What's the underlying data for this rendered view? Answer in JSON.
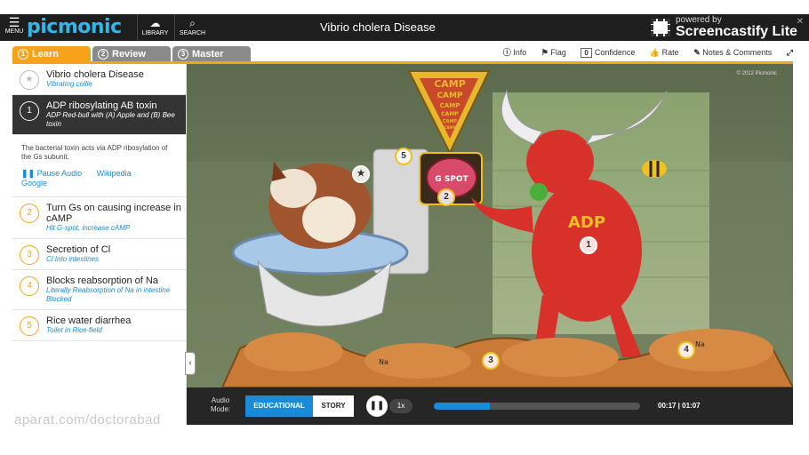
{
  "header": {
    "menu_label": "MENU",
    "logo_text": "picmonic",
    "library_label": "LIBRARY",
    "search_label": "SEARCH",
    "title": "Vibrio cholera Disease"
  },
  "recorder": {
    "powered_by": "powered by",
    "name": "Screencastify Lite"
  },
  "tabs": [
    {
      "num": "1",
      "label": "Learn"
    },
    {
      "num": "2",
      "label": "Review"
    },
    {
      "num": "3",
      "label": "Master"
    }
  ],
  "toolbar": {
    "info": "Info",
    "flag": "Flag",
    "confidence_value": "0",
    "confidence": "Confidence",
    "rate": "Rate",
    "notes": "Notes & Comments"
  },
  "sidebar": {
    "items": [
      {
        "num": "★",
        "title": "Vibrio cholera Disease",
        "sub": "Vibrating collie"
      },
      {
        "num": "1",
        "title": "ADP ribosylating AB toxin",
        "sub": "ADP Red-bull with (A) Apple and (B) Bee toxin"
      },
      {
        "num": "2",
        "title": "Turn Gs on causing increase in cAMP",
        "sub": "Hit G-spot, increase cAMP"
      },
      {
        "num": "3",
        "title": "Secretion of Cl",
        "sub": "Cl Into intestines"
      },
      {
        "num": "4",
        "title": "Blocks reabsorption of Na",
        "sub": "Literally Reabsorption of Na in intestine Blocked"
      },
      {
        "num": "5",
        "title": "Rice water diarrhea",
        "sub": "Toilet in Rice-field"
      }
    ],
    "description": "The bacterial toxin acts via ADP ribosylation of the Gs subunit.",
    "links": {
      "pause": "Pause Audio",
      "wikipedia": "Wikipedia",
      "google": "Google"
    }
  },
  "scene": {
    "copyright": "© 2012 Picmonic",
    "banner": [
      "CAMP",
      "CAMP",
      "CAMP",
      "CAMP",
      "CAMP",
      "CAMP"
    ],
    "gspot": "G SPOT",
    "adp": "ADP",
    "na1": "Na",
    "na2": "Na",
    "hotspots": [
      "★",
      "1",
      "2",
      "3",
      "4",
      "5"
    ]
  },
  "controls": {
    "audio_mode": "Audio Mode:",
    "educational": "EDUCATIONAL",
    "story": "STORY",
    "speed": "1x",
    "progress_fraction": 0.27,
    "time": "00:17 | 01:07"
  },
  "watermark": "aparat.com/doctorabad",
  "colors": {
    "accent": "#f7a21b",
    "link": "#1a8bd8",
    "topbar": "#1e1e1e"
  }
}
